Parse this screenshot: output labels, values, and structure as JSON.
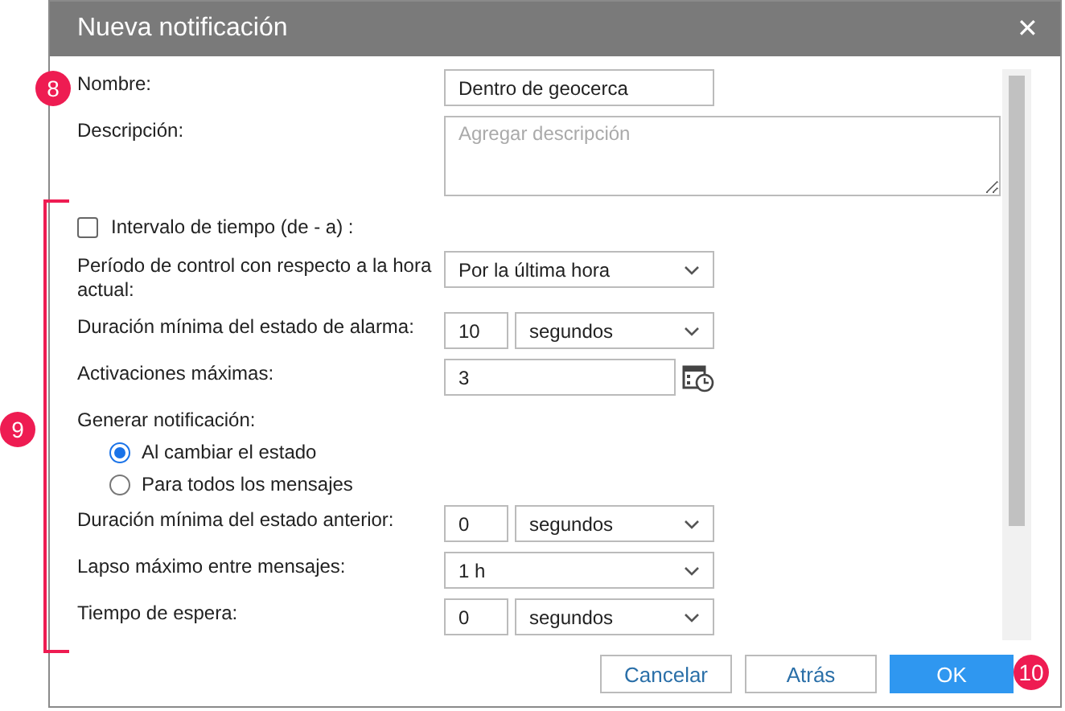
{
  "window": {
    "title": "Nueva notificación",
    "close": "✕"
  },
  "annotations": [
    {
      "label": "8"
    },
    {
      "label": "9"
    },
    {
      "label": "10"
    }
  ],
  "name": {
    "label": "Nombre:",
    "value": "Dentro de geocerca"
  },
  "description": {
    "label": "Descripción:",
    "placeholder": "Agregar descripción"
  },
  "interval": {
    "label": "Intervalo de tiempo (de - a)  :",
    "checked": false
  },
  "rows": [
    {
      "kind": "select",
      "label": "Período de control con respecto a la hora actual:",
      "value": "Por la última hora"
    },
    {
      "kind": "number-unit",
      "label": "Duración mínima del estado de alarma:",
      "value": "10",
      "unit": "segundos"
    },
    {
      "kind": "input-icon",
      "label": "Activaciones máximas:",
      "value": "3"
    },
    {
      "kind": "radios",
      "label": "Generar notificación:",
      "options": [
        {
          "label": "Al cambiar el estado",
          "selected": true
        },
        {
          "label": "Para todos los mensajes",
          "selected": false
        }
      ]
    },
    {
      "kind": "number-unit",
      "label": "Duración mínima del estado anterior:",
      "value": "0",
      "unit": "segundos"
    },
    {
      "kind": "select",
      "label": "Lapso máximo entre mensajes:",
      "value": "1 h"
    },
    {
      "kind": "number-unit",
      "label": "Tiempo de espera:",
      "value": "0",
      "unit": "segundos"
    }
  ],
  "buttons": [
    {
      "label": "Cancelar",
      "kind": "secondary"
    },
    {
      "label": "Atrás",
      "kind": "secondary"
    },
    {
      "label": "OK",
      "kind": "primary"
    }
  ]
}
